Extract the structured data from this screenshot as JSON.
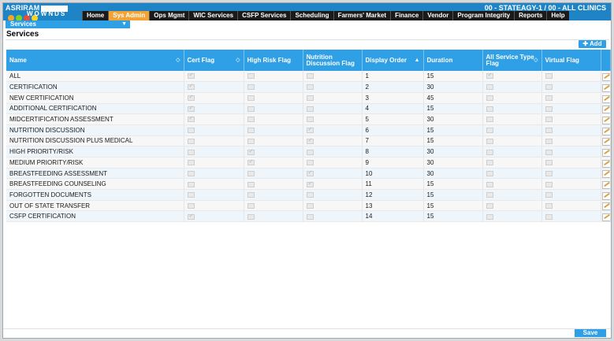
{
  "header": {
    "user": "ASRIRAM",
    "clinic": "00 - STATEAGY-1 / 00 - ALL CLINICS",
    "logo_text": "WOWNDS"
  },
  "nav": [
    "Home",
    "Sys Admin",
    "Ops Mgmt",
    "WIC Services",
    "CSFP Services",
    "Scheduling",
    "Farmers' Market",
    "Finance",
    "Vendor",
    "Program Integrity",
    "Reports",
    "Help"
  ],
  "subnav": {
    "selected": "Services"
  },
  "page": {
    "title": "Services",
    "add_label": "Add",
    "save_label": "Save"
  },
  "columns": [
    "Name",
    "Cert Flag",
    "High Risk Flag",
    "Nutrition Discussion Flag",
    "Display Order",
    "Duration",
    "All Service Type Flag",
    "Virtual Flag"
  ],
  "rows": [
    {
      "name": "ALL",
      "cert": true,
      "high_risk": false,
      "nutrition": false,
      "order": "1",
      "duration": "15",
      "all_service": true,
      "virtual": false
    },
    {
      "name": "CERTIFICATION",
      "cert": true,
      "high_risk": false,
      "nutrition": false,
      "order": "2",
      "duration": "30",
      "all_service": false,
      "virtual": false
    },
    {
      "name": "NEW CERTIFICATION",
      "cert": true,
      "high_risk": false,
      "nutrition": false,
      "order": "3",
      "duration": "45",
      "all_service": false,
      "virtual": false
    },
    {
      "name": "ADDITIONAL CERTIFICATION",
      "cert": true,
      "high_risk": false,
      "nutrition": false,
      "order": "4",
      "duration": "15",
      "all_service": false,
      "virtual": false
    },
    {
      "name": "MIDCERTIFICATION ASSESSMENT",
      "cert": true,
      "high_risk": false,
      "nutrition": false,
      "order": "5",
      "duration": "30",
      "all_service": false,
      "virtual": false
    },
    {
      "name": "NUTRITION DISCUSSION",
      "cert": false,
      "high_risk": false,
      "nutrition": true,
      "order": "6",
      "duration": "15",
      "all_service": false,
      "virtual": false
    },
    {
      "name": "NUTRITION DISCUSSION PLUS MEDICAL",
      "cert": false,
      "high_risk": false,
      "nutrition": true,
      "order": "7",
      "duration": "15",
      "all_service": false,
      "virtual": false
    },
    {
      "name": "HIGH PRIORITY/RISK",
      "cert": false,
      "high_risk": true,
      "nutrition": false,
      "order": "8",
      "duration": "30",
      "all_service": false,
      "virtual": false
    },
    {
      "name": "MEDIUM PRIORITY/RISK",
      "cert": false,
      "high_risk": true,
      "nutrition": false,
      "order": "9",
      "duration": "30",
      "all_service": false,
      "virtual": false
    },
    {
      "name": "BREASTFEEDING ASSESSMENT",
      "cert": false,
      "high_risk": false,
      "nutrition": true,
      "order": "10",
      "duration": "30",
      "all_service": false,
      "virtual": false
    },
    {
      "name": "BREASTFEEDING COUNSELING",
      "cert": false,
      "high_risk": false,
      "nutrition": true,
      "order": "11",
      "duration": "15",
      "all_service": false,
      "virtual": false
    },
    {
      "name": "FORGOTTEN DOCUMENTS",
      "cert": false,
      "high_risk": false,
      "nutrition": false,
      "order": "12",
      "duration": "15",
      "all_service": false,
      "virtual": false
    },
    {
      "name": "OUT OF STATE TRANSFER",
      "cert": false,
      "high_risk": false,
      "nutrition": false,
      "order": "13",
      "duration": "15",
      "all_service": false,
      "virtual": false
    },
    {
      "name": "CSFP CERTIFICATION",
      "cert": true,
      "high_risk": false,
      "nutrition": false,
      "order": "14",
      "duration": "15",
      "all_service": false,
      "virtual": false
    }
  ],
  "icons": {
    "add": "plus-icon",
    "edit": "edit-icon",
    "sort": "sort-icon",
    "dropdown": "chevron-down-icon"
  },
  "colors": {
    "nav_active": "#f3a334",
    "accent": "#2f9fe6",
    "topbar": "#1e84c6"
  }
}
